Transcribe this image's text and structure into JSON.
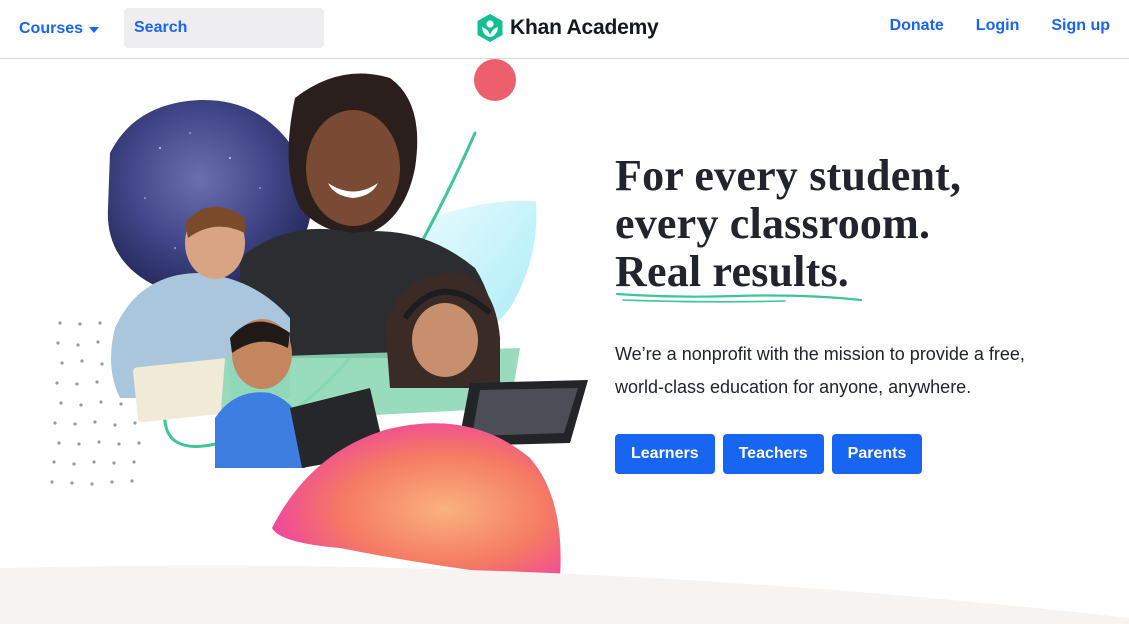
{
  "header": {
    "courses_label": "Courses",
    "search_placeholder": "Search",
    "logo_text": "Khan Academy",
    "nav": [
      {
        "label": "Donate"
      },
      {
        "label": "Login"
      },
      {
        "label": "Sign up"
      }
    ]
  },
  "hero": {
    "headline": [
      "For every student,",
      "every classroom.",
      "Real results."
    ],
    "mission": [
      "We’re a nonprofit with the mission to provide a free,",
      "world-class education for anyone, anywhere."
    ],
    "buttons": [
      {
        "label": "Learners"
      },
      {
        "label": "Teachers"
      },
      {
        "label": "Parents"
      }
    ]
  },
  "colors": {
    "brand_blue": "#1865f2",
    "text_dark": "#21242c",
    "logo_green": "#14bf96",
    "accent_green": "#3ec59a",
    "bottom_band": "#f7f3f1"
  },
  "icons": {
    "courses_caret": "chevron-down-icon",
    "search": "search-icon",
    "logo": "khan-academy-hexagon-logo"
  }
}
